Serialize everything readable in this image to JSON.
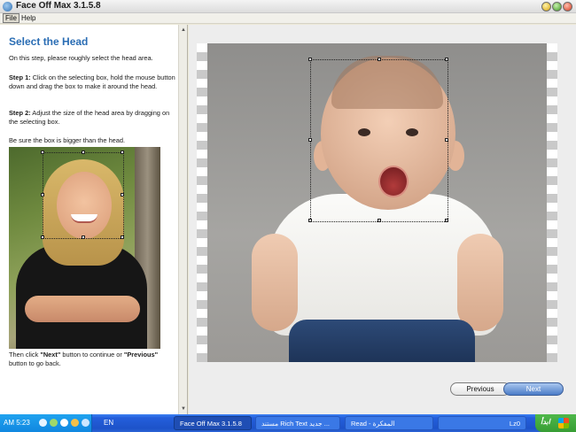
{
  "window": {
    "title": "Face Off Max  3.1.5.8"
  },
  "menu": {
    "items": [
      "File",
      "Help"
    ]
  },
  "instructions": {
    "heading": "Select the Head",
    "intro": "On this step, please roughly select the head area.",
    "step1_label": "Step 1:",
    "step1_text": " Click on the selecting box, hold the mouse button down and drag the box to make it around the head.",
    "step2_label": "Step 2:",
    "step2_text": " Adjust the size of the head area by dragging on the selecting box.",
    "note": "Be sure the box is bigger than the head.",
    "footer_pre": "Then click ",
    "footer_next": "\"Next\"",
    "footer_mid": " button to continue or ",
    "footer_prev": "\"Previous\"",
    "footer_post": " button to go back."
  },
  "buttons": {
    "previous": "Previous",
    "next": "Next"
  },
  "taskbar": {
    "clock": "AM 5:23",
    "language": "EN",
    "tasks": [
      "Face Off Max  3.1.5.8",
      "مستند Rich Text جديد ...",
      "Read - المفكرة",
      "Lz0"
    ],
    "start_label": "ابدأ"
  },
  "icons": {
    "app": "face-off-app-icon",
    "start": "windows-flag-icon"
  }
}
